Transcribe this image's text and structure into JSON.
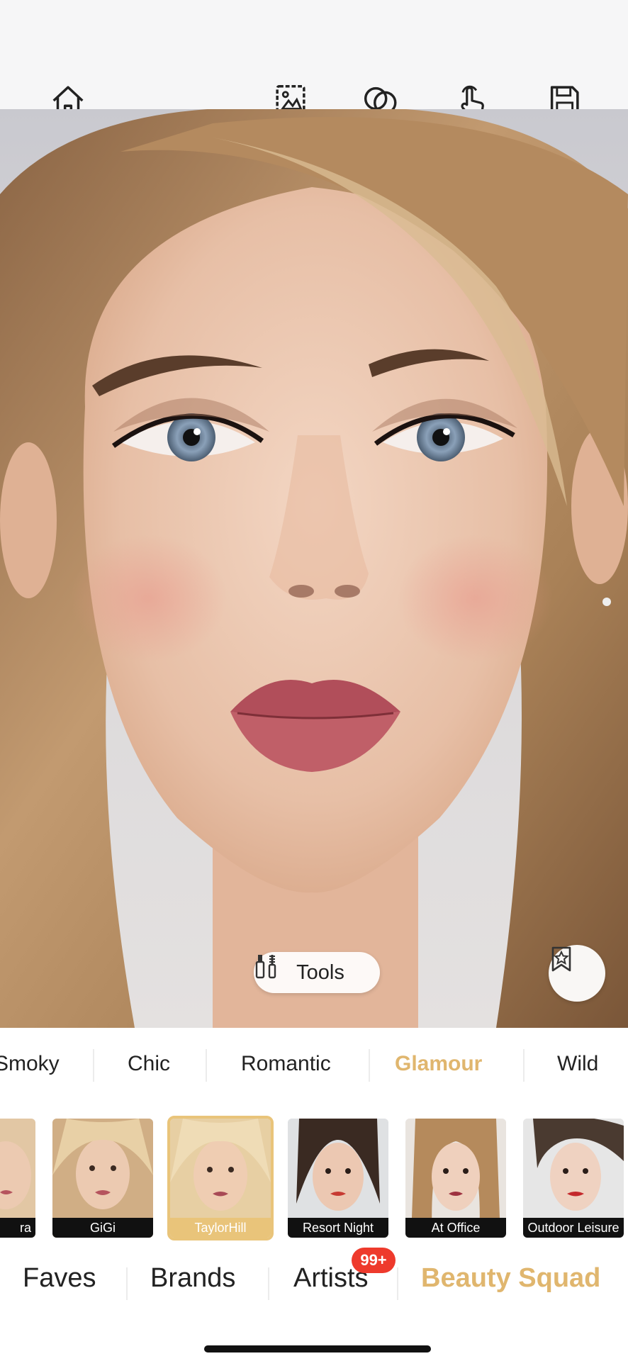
{
  "toolbar": {
    "icons": [
      "home-icon",
      "photo-compare-icon",
      "face-swap-icon",
      "touch-gesture-icon",
      "save-icon"
    ]
  },
  "photo": {
    "tools_label": "Tools",
    "favorite_icon": "bookmark-star-icon"
  },
  "style_tabs": [
    {
      "label": "Smoky",
      "active": false
    },
    {
      "label": "Chic",
      "active": false
    },
    {
      "label": "Romantic",
      "active": false
    },
    {
      "label": "Glamour",
      "active": true
    },
    {
      "label": "Wild",
      "active": false
    }
  ],
  "looks": [
    {
      "label": "ra",
      "selected": false
    },
    {
      "label": "GiGi",
      "selected": false
    },
    {
      "label": "TaylorHill",
      "selected": true
    },
    {
      "label": "Resort Night",
      "selected": false
    },
    {
      "label": "At Office",
      "selected": false
    },
    {
      "label": "Outdoor Leisure",
      "selected": false
    }
  ],
  "categories": [
    {
      "label": "Faves",
      "active": false
    },
    {
      "label": "Brands",
      "active": false
    },
    {
      "label": "Artists",
      "active": false
    },
    {
      "label": "Beauty Squad",
      "active": true
    }
  ],
  "artists_badge": "99+",
  "colors": {
    "accent": "#e0b66e",
    "badge": "#ee3a2c",
    "lip": "#b5545e"
  }
}
